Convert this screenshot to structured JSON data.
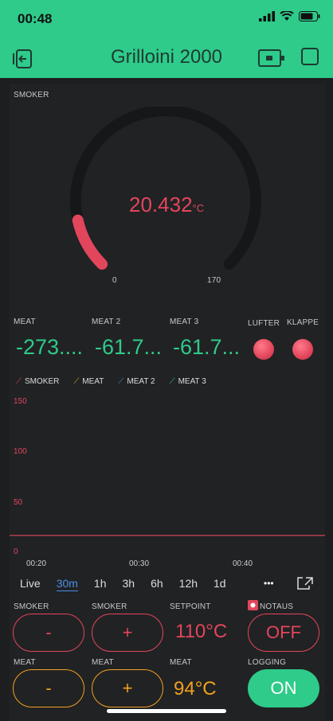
{
  "status": {
    "time": "00:48"
  },
  "app": {
    "title": "Grilloini 2000"
  },
  "gauge": {
    "label": "SMOKER",
    "value": "20.432",
    "unit": "°C",
    "min": "0",
    "max": "170",
    "fraction": 0.12
  },
  "displays": [
    {
      "label": "MEAT",
      "value": "-273...."
    },
    {
      "label": "MEAT 2",
      "value": "-61.7..."
    },
    {
      "label": "MEAT 3",
      "value": "-61.7..."
    }
  ],
  "leds": [
    {
      "label": "LUFTER"
    },
    {
      "label": "KLAPPE"
    }
  ],
  "chart_data": {
    "type": "line",
    "series": [
      {
        "name": "SMOKER",
        "color": "#e2465c",
        "values": [
          21,
          21,
          21,
          21,
          21,
          21
        ]
      },
      {
        "name": "MEAT",
        "color": "#f0a11e",
        "values": []
      },
      {
        "name": "MEAT 2",
        "color": "#4a8fe8",
        "values": []
      },
      {
        "name": "MEAT 3",
        "color": "#2ecb8a",
        "values": []
      }
    ],
    "y_ticks": [
      "150",
      "100",
      "50",
      "0"
    ],
    "ylim": [
      0,
      165
    ],
    "x_ticks": [
      "00:20",
      "00:30",
      "00:40"
    ]
  },
  "ranges": [
    "Live",
    "30m",
    "1h",
    "3h",
    "6h",
    "12h",
    "1d"
  ],
  "active_range": "30m",
  "more_label": "•••",
  "controls": {
    "row1": {
      "label_a": "SMOKER",
      "label_b": "SMOKER",
      "label_c": "SETPOINT",
      "label_d": "NOTAUS",
      "minus": "-",
      "plus": "+",
      "setpoint": "110°C",
      "notaus": "OFF"
    },
    "row2": {
      "label_a": "MEAT",
      "label_b": "MEAT",
      "label_c": "MEAT",
      "label_d": "LOGGING",
      "minus": "-",
      "plus": "+",
      "setpoint": "94°C",
      "logging": "ON"
    }
  },
  "colors": {
    "accent": "#2ecb8a",
    "red": "#e2465c",
    "orange": "#f0a11e",
    "blue": "#4a8fe8"
  }
}
